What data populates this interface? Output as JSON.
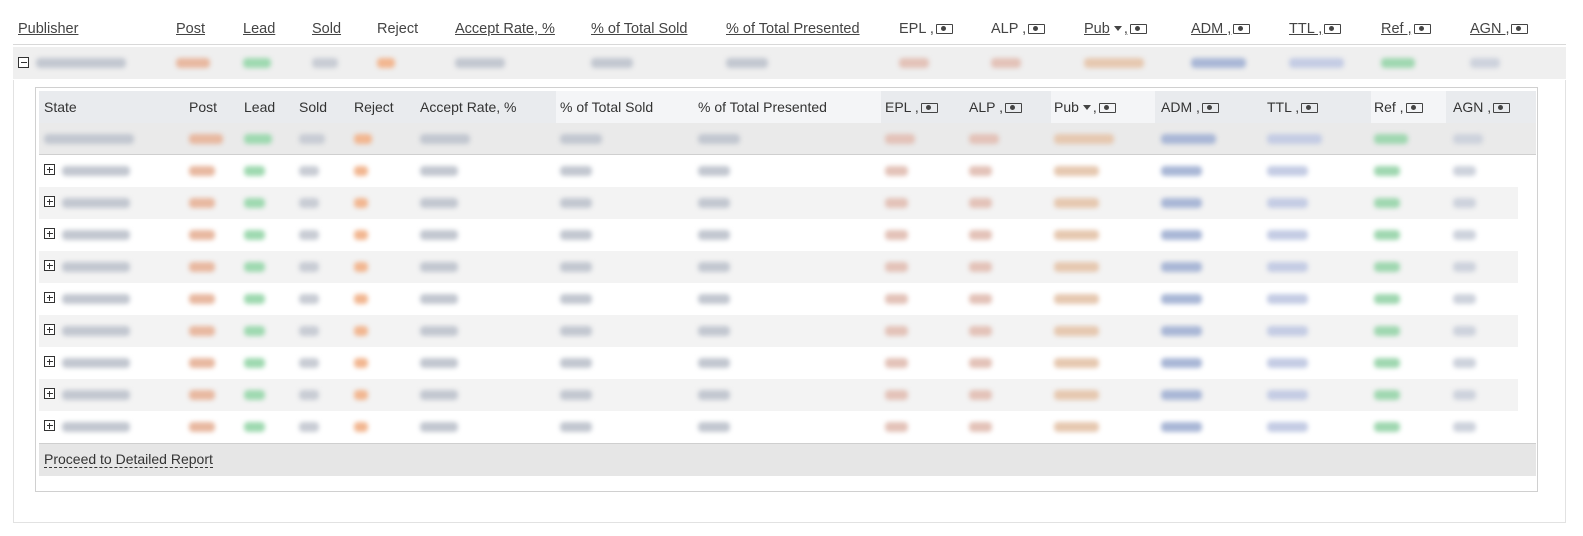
{
  "outer_header": [
    {
      "label": "Publisher",
      "underline": true
    },
    {
      "label": "Post",
      "underline": true
    },
    {
      "label": "Lead",
      "underline": true
    },
    {
      "label": "Sold",
      "underline": true
    },
    {
      "label": "Reject",
      "underline": false
    },
    {
      "label": "Accept Rate, %",
      "underline": true
    },
    {
      "label": "% of Total Sold",
      "underline": true
    },
    {
      "label": "% of Total Presented",
      "underline": true
    },
    {
      "label": "EPL ,",
      "underline": false,
      "money": true
    },
    {
      "label": "ALP ,",
      "underline": false,
      "money": true
    },
    {
      "label": "Pub",
      "underline": true,
      "sort": true,
      "money": true
    },
    {
      "label": "ADM ,",
      "underline": true,
      "money": true
    },
    {
      "label": "TTL ,",
      "underline": true,
      "money": true
    },
    {
      "label": "Ref ,",
      "underline": true,
      "money": true
    },
    {
      "label": "AGN ,",
      "underline": true,
      "money": true
    }
  ],
  "inner_header": [
    {
      "label": "State"
    },
    {
      "label": "Post"
    },
    {
      "label": "Lead"
    },
    {
      "label": "Sold"
    },
    {
      "label": "Reject"
    },
    {
      "label": "Accept Rate, %"
    },
    {
      "label": "% of Total Sold"
    },
    {
      "label": "% of Total Presented"
    },
    {
      "label": "EPL ,",
      "money": true
    },
    {
      "label": "ALP ,",
      "money": true
    },
    {
      "label": "Pub",
      "sort": true,
      "money": true
    },
    {
      "label": "ADM ,",
      "money": true
    },
    {
      "label": "TTL ,",
      "money": true
    },
    {
      "label": "Ref ,",
      "money": true
    },
    {
      "label": "AGN ,",
      "money": true
    }
  ],
  "state_row_count": 9,
  "footer": {
    "proceed_label": "Proceed to Detailed Report"
  },
  "colors": {
    "post": "#e8b8a0",
    "lead": "#9ed9b0",
    "sold": "#c8ccd4",
    "reject": "#f2b690",
    "neutral": "#c2c7d0",
    "epl": "#e3c2b8",
    "pub": "#e6c8b0",
    "adm": "#a9b7d6",
    "ttl": "#c4cce4",
    "ref": "#9fd7b0",
    "agn": "#cdd2dc"
  }
}
